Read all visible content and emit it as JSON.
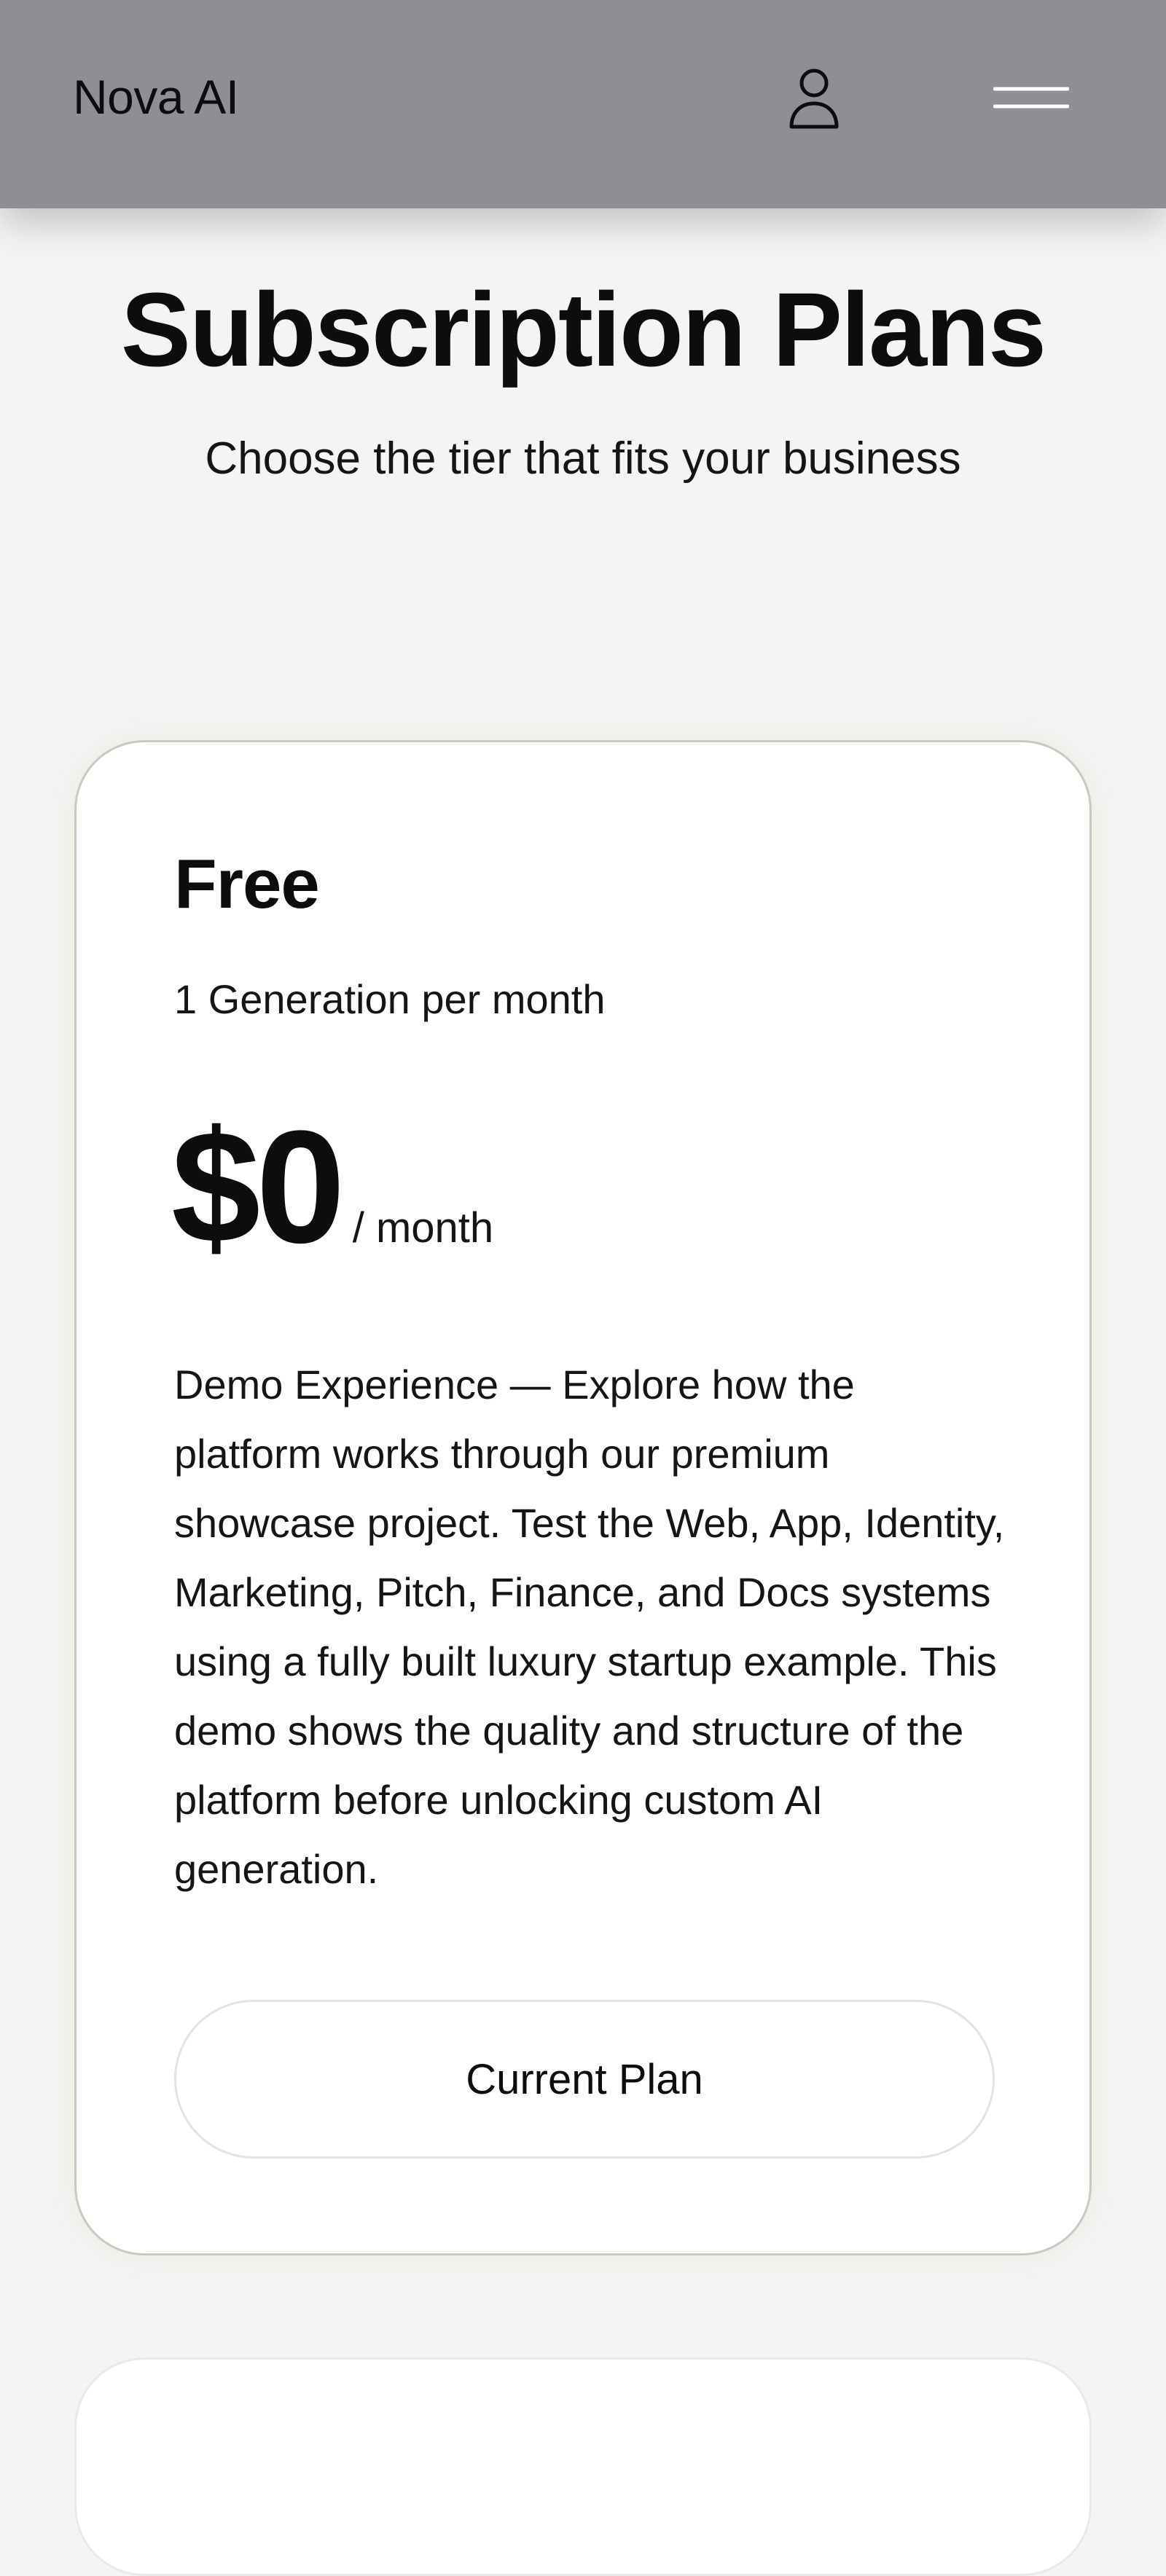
{
  "header": {
    "brand": "Nova AI",
    "user_icon": "user-icon",
    "menu_icon": "hamburger-menu-icon"
  },
  "page": {
    "title": "Subscription Plans",
    "subtitle": "Choose the tier that fits your business"
  },
  "plans": [
    {
      "name": "Free",
      "quota": "1 Generation per month",
      "price": "$0",
      "period": "/ month",
      "description": "Demo Experience — Explore how the platform works through our premium showcase project. Test the Web, App, Identity, Marketing, Pitch, Finance, and Docs systems using a fully built luxury startup example. This demo shows the quality and structure of the platform before unlocking custom AI generation.",
      "button_label": "Current Plan"
    }
  ],
  "colors": {
    "header_bg": "#8f8e95",
    "page_bg": "#f4f4f6",
    "card_bg": "#ffffff",
    "text": "#0d0d0f"
  }
}
